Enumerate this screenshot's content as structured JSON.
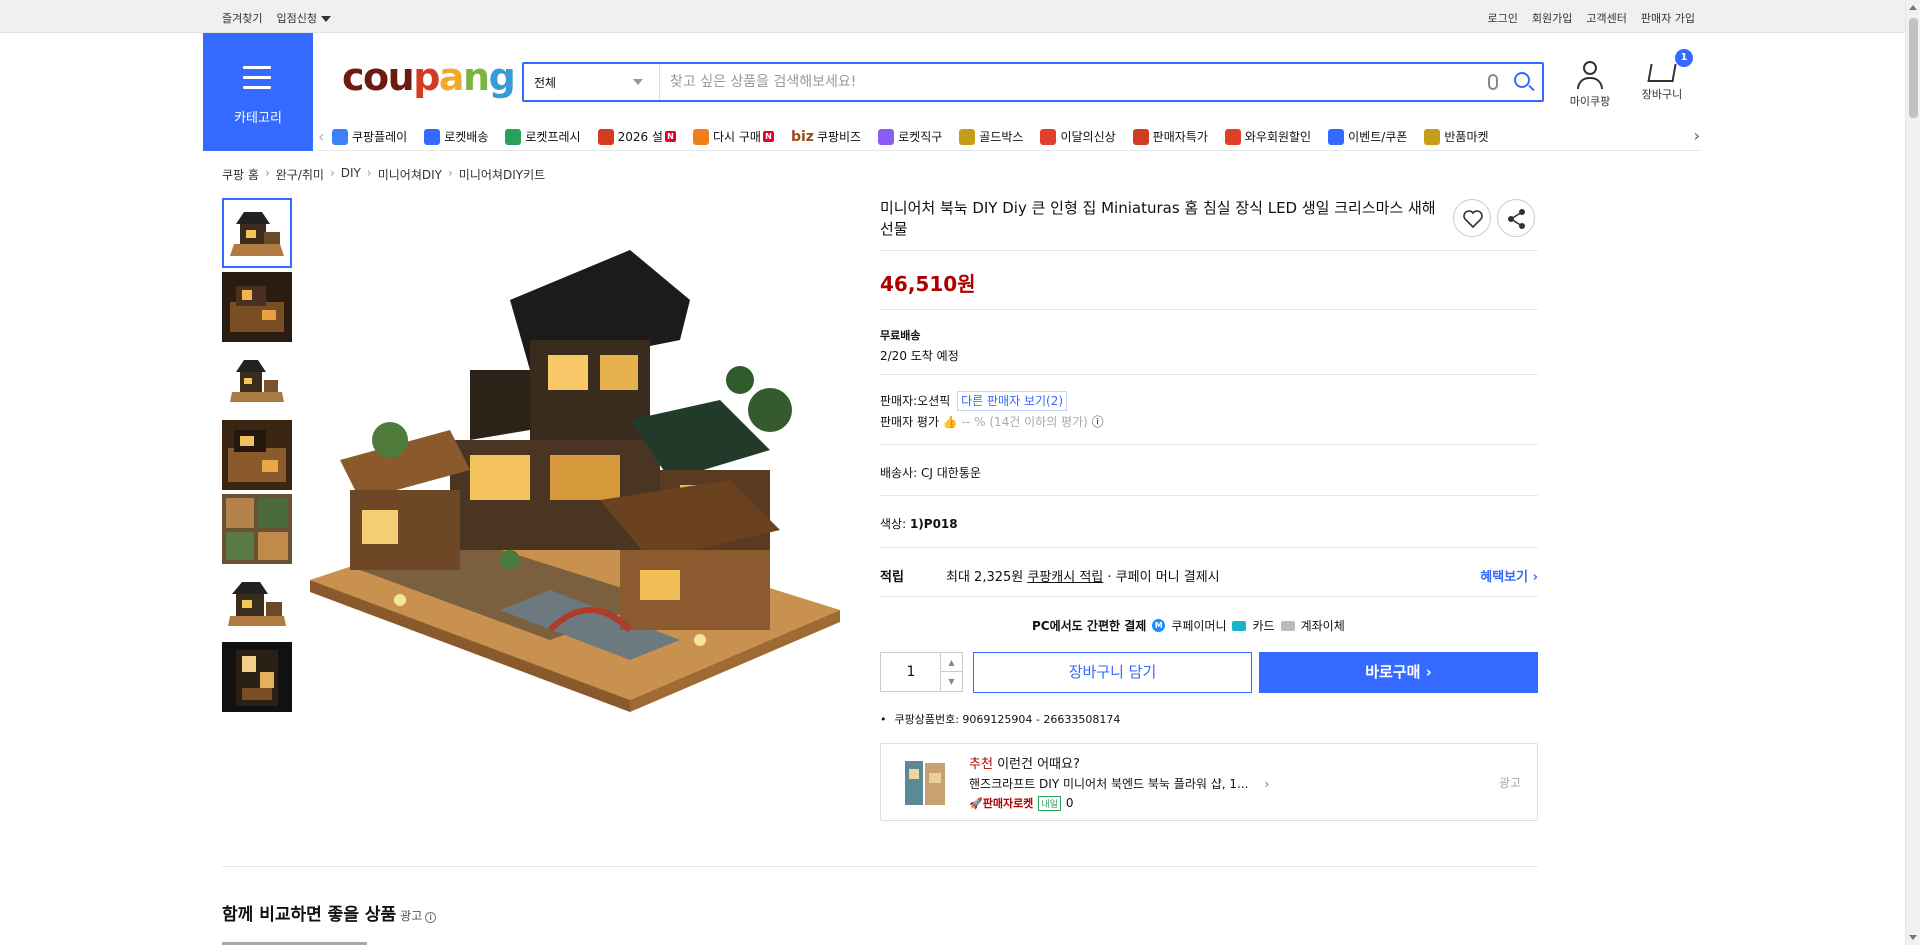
{
  "topbar": {
    "left": [
      "즐겨찾기",
      "입점신청"
    ],
    "right": [
      "로그인",
      "회원가입",
      "고객센터",
      "판매자 가입"
    ]
  },
  "header": {
    "category_label": "카테고리",
    "logo": [
      "cou",
      "p",
      "a",
      "n",
      "g"
    ],
    "search_category": "전체",
    "search_placeholder": "찾고 싶은 상품을 검색해보세요!",
    "mycoupang": "마이쿠팡",
    "cart": "장바구니",
    "cart_count": "1"
  },
  "shortcuts": [
    {
      "label": "쿠팡플레이",
      "icon": "play-icon",
      "color": "#3b82f6"
    },
    {
      "label": "로켓배송",
      "icon": "rocket-icon",
      "color": "#346aff"
    },
    {
      "label": "로켓프레시",
      "icon": "fresh-rocket-icon",
      "color": "#2aa05a"
    },
    {
      "label": "2026 설",
      "icon": "gift-icon",
      "color": "#d33b22",
      "badge": "N"
    },
    {
      "label": "다시 구매",
      "icon": "home-icon",
      "color": "#f07f1b",
      "badge": "N"
    },
    {
      "label": "쿠팡비즈",
      "icon": "biz-icon",
      "color": "#9b4a1a",
      "prefix": "biz"
    },
    {
      "label": "로켓직구",
      "icon": "globe-icon",
      "color": "#8b5cf6"
    },
    {
      "label": "골드박스",
      "icon": "goldbox-icon",
      "color": "#c59d1a"
    },
    {
      "label": "이달의신상",
      "icon": "new-icon",
      "color": "#e0402b"
    },
    {
      "label": "판매자특가",
      "icon": "sale-icon",
      "color": "#d33b22"
    },
    {
      "label": "와우회원할인",
      "icon": "wow-icon",
      "color": "#e0402b"
    },
    {
      "label": "이벤트/쿠폰",
      "icon": "coupon-icon",
      "color": "#346aff"
    },
    {
      "label": "반품마켓",
      "icon": "market-icon",
      "color": "#c59d1a"
    }
  ],
  "breadcrumb": [
    "쿠팡 홈",
    "완구/취미",
    "DIY",
    "미니어쳐DIY",
    "미니어쳐DIY키트"
  ],
  "product": {
    "title": "미니어처 북눅 DIY Diy 큰 인형 집 Miniaturas 홈 침실 장식 LED 생일 크리스마스 새해 선물",
    "price": "46,510원",
    "delivery_label": "무료배송",
    "delivery_date": "2/20 도착 예정",
    "seller_label": "판매자:",
    "seller_name": "오션픽",
    "other_sellers": "다른 판매자 보기(2)",
    "seller_rating_label": "판매자 평가",
    "seller_rating_value": "-- % (14건 이하의 평가)",
    "shipper_label": "배송사:",
    "shipper": "CJ 대한통운",
    "color_label": "색상:",
    "color_value": "1)P018",
    "reward_label": "적립",
    "reward_prefix": "최대 2,325원",
    "reward_link": "쿠팡캐시 적립",
    "reward_suffix": "· 쿠페이 머니 결제시",
    "reward_benefit": "혜택보기 ›",
    "pc_pay_label": "PC에서도 간편한 결제",
    "pay_methods": [
      "쿠페이머니",
      "카드",
      "계좌이체"
    ],
    "quantity": "1",
    "add_to_cart": "장바구니 담기",
    "buy_now": "바로구매",
    "product_id": "쿠팡상품번호: 9069125904 - 26633508174"
  },
  "recommend": {
    "tag": "추천",
    "heading": "이런건 어때요?",
    "item_title": "핸즈크라프트 DIY 미니어처 북엔드 북눅 플라워 샵, 1...",
    "seller_rocket": "판매자로켓",
    "tomorrow": "내일",
    "count": "0",
    "ad": "광고"
  },
  "compare": {
    "title": "함께 비교하면 좋을 상품",
    "ad": "광고"
  }
}
